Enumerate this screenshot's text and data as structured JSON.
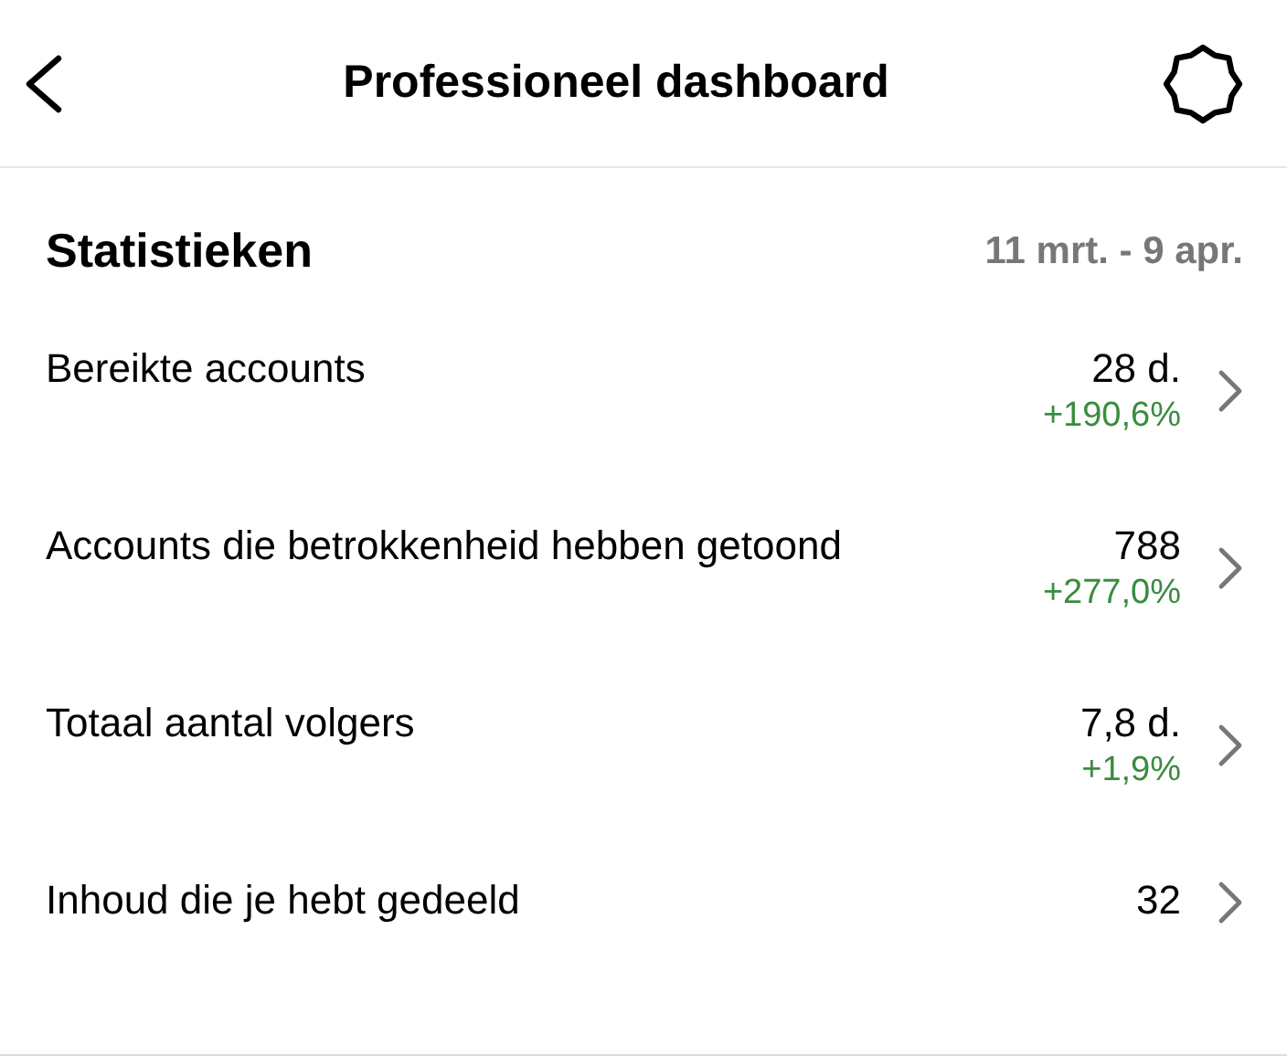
{
  "header": {
    "title": "Professioneel dashboard"
  },
  "stats": {
    "title": "Statistieken",
    "period": "11 mrt. - 9 apr.",
    "rows": [
      {
        "label": "Bereikte accounts",
        "value": "28 d.",
        "change": "+190,6%"
      },
      {
        "label": "Accounts die betrokkenheid hebben getoond",
        "value": "788",
        "change": "+277,0%"
      },
      {
        "label": "Totaal aantal volgers",
        "value": "7,8 d.",
        "change": "+1,9%"
      },
      {
        "label": "Inhoud die je hebt gedeeld",
        "value": "32"
      }
    ]
  }
}
